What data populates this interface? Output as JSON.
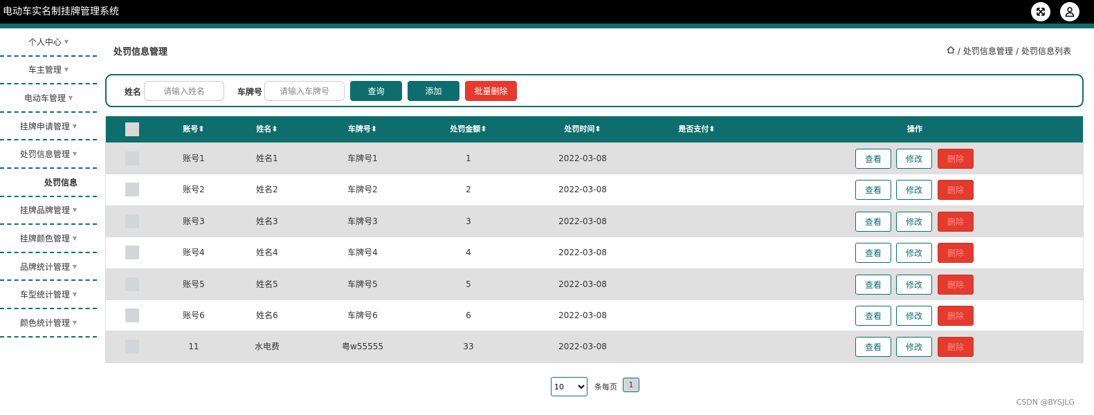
{
  "app": {
    "title": "电动车实名制挂牌管理系统"
  },
  "header_icons": [
    "fullscreen-icon",
    "user-icon"
  ],
  "sidebar": {
    "items": [
      {
        "label": "个人中心"
      },
      {
        "label": "车主管理"
      },
      {
        "label": "电动车管理"
      },
      {
        "label": "挂牌申请管理"
      },
      {
        "label": "处罚信息管理"
      },
      {
        "label": "处罚信息",
        "sub": true
      },
      {
        "label": "挂牌品牌管理"
      },
      {
        "label": "挂牌颜色管理"
      },
      {
        "label": "品牌统计管理"
      },
      {
        "label": "车型统计管理"
      },
      {
        "label": "颜色统计管理"
      }
    ]
  },
  "page": {
    "title": "处罚信息管理",
    "breadcrumb": [
      "处罚信息管理",
      "处罚信息列表"
    ]
  },
  "search": {
    "name_label": "姓名",
    "name_placeholder": "请输入姓名",
    "plate_label": "车牌号",
    "plate_placeholder": "请输入车牌号",
    "query_label": "查询",
    "add_label": "添加",
    "batch_delete_label": "批量删除"
  },
  "table": {
    "columns": [
      "账号",
      "姓名",
      "车牌号",
      "处罚金额",
      "处罚时间",
      "是否支付",
      "操作"
    ],
    "sort_glyph": "⬍",
    "rows": [
      {
        "account": "账号1",
        "name": "姓名1",
        "plate": "车牌号1",
        "amount": "1",
        "time": "2022-03-08",
        "paid": ""
      },
      {
        "account": "账号2",
        "name": "姓名2",
        "plate": "车牌号2",
        "amount": "2",
        "time": "2022-03-08",
        "paid": ""
      },
      {
        "account": "账号3",
        "name": "姓名3",
        "plate": "车牌号3",
        "amount": "3",
        "time": "2022-03-08",
        "paid": ""
      },
      {
        "account": "账号4",
        "name": "姓名4",
        "plate": "车牌号4",
        "amount": "4",
        "time": "2022-03-08",
        "paid": ""
      },
      {
        "account": "账号5",
        "name": "姓名5",
        "plate": "车牌号5",
        "amount": "5",
        "time": "2022-03-08",
        "paid": ""
      },
      {
        "account": "账号6",
        "name": "姓名6",
        "plate": "车牌号6",
        "amount": "6",
        "time": "2022-03-08",
        "paid": ""
      },
      {
        "account": "11",
        "name": "水电费",
        "plate": "粤w55555",
        "amount": "33",
        "time": "2022-03-08",
        "paid": ""
      }
    ],
    "actions": {
      "view": "查看",
      "edit": "修改",
      "delete": "删除"
    }
  },
  "pager": {
    "page_size": "10",
    "page_size_options": [
      "10"
    ],
    "per_page_label": "条每页",
    "current_page": "1"
  },
  "watermark": "CSDN @BYSJLG",
  "colors": {
    "teal": "#0e6e6e",
    "danger": "#e53a2e",
    "header_bg": "#000000"
  }
}
